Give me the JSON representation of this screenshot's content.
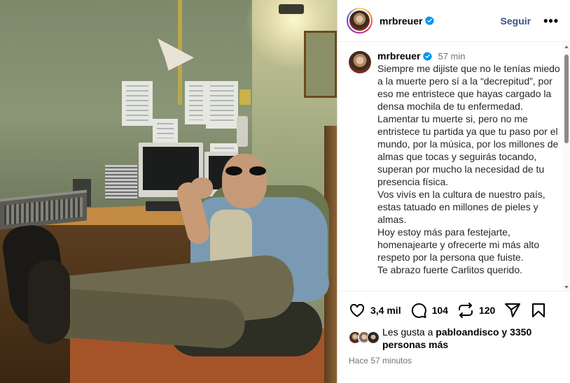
{
  "post": {
    "username": "mrbreuer",
    "follow_label": "Seguir",
    "more_label": "•••",
    "time_short": "57 min",
    "time_long": "Hace 57 minutos",
    "caption": [
      "Siempre me dijiste que no le tenías miedo a la muerte pero sí a la “decrepitud”, por eso me entristece que hayas cargado la densa mochila de tu enfermedad.",
      "Lamentar tu muerte si, pero no me entristece tu partida ya que tu paso por el mundo, por la música, por los millones de almas que tocas y seguirás tocando, superan por mucho la necesidad de tu presencia física.",
      "Vos vivís en la cultura de nuestro país, estas tatuado en millones de pieles y almas.",
      "Hoy estoy más para festejarte, homenajearte y ofrecerte mi más alto respeto por la persona que fuiste.",
      "Te abrazo fuerte Carlitos querido."
    ],
    "counts": {
      "likes": "3,4 mil",
      "comments": "104",
      "reposts": "120"
    },
    "liked_by": {
      "prefix": "Les gusta a ",
      "user": "pabloandisco",
      "suffix": " y 3350 personas más"
    }
  },
  "colors": {
    "follow_blue": "#385185",
    "verified_blue": "#0095f6",
    "muted": "#737373"
  },
  "icons": [
    "heart-icon",
    "comment-icon",
    "repost-icon",
    "share-icon",
    "bookmark-icon",
    "verified-icon"
  ]
}
